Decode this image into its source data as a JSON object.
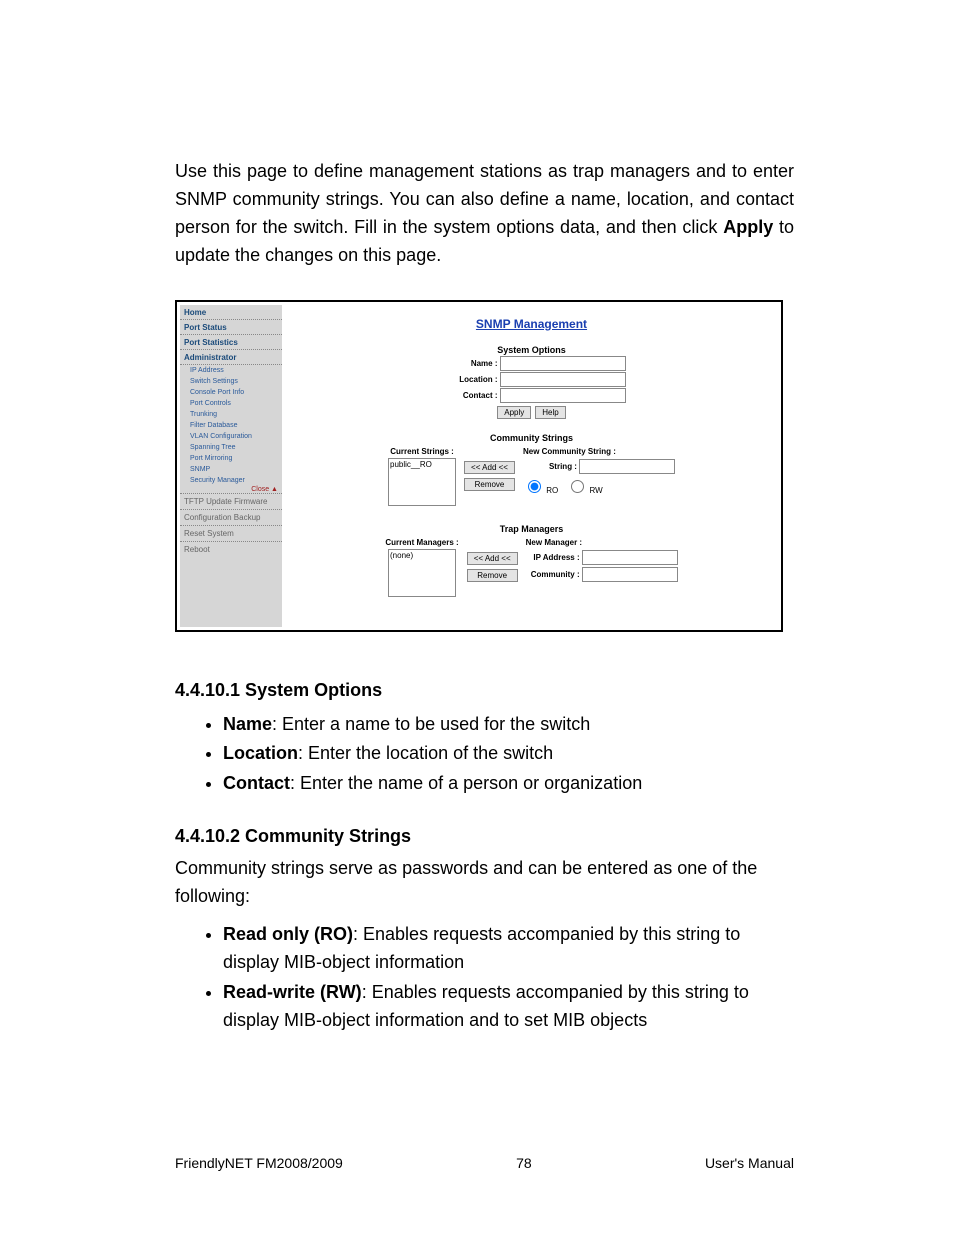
{
  "intro": {
    "pre": "Use this page to define management stations as trap managers and to enter SNMP community strings. You can also define a name, location, and contact person for the switch. Fill in the system options data, and then click ",
    "bold": "Apply",
    "post": " to update the changes on this page."
  },
  "screenshot": {
    "title": "SNMP Management",
    "sidebar": {
      "home": "Home",
      "port_status": "Port Status",
      "port_statistics": "Port Statistics",
      "administrator": "Administrator",
      "subs": [
        "IP Address",
        "Switch Settings",
        "Console Port Info",
        "Port Controls",
        "Trunking",
        "Filter Database",
        "VLAN Configuration",
        "Spanning Tree",
        "Port Mirroring",
        "SNMP",
        "Security Manager"
      ],
      "close": "Close ▲",
      "tftp": "TFTP Update Firmware",
      "cfg": "Configuration Backup",
      "reset": "Reset System",
      "reboot": "Reboot"
    },
    "system_options": {
      "heading": "System Options",
      "name_label": "Name :",
      "location_label": "Location :",
      "contact_label": "Contact :",
      "apply": "Apply",
      "help": "Help"
    },
    "community": {
      "heading": "Community Strings",
      "current_label": "Current Strings :",
      "new_label": "New Community String :",
      "current_value": "public__RO",
      "add": "<< Add <<",
      "remove": "Remove",
      "string_label": "String :",
      "ro": "RO",
      "rw": "RW"
    },
    "trap": {
      "heading": "Trap Managers",
      "current_label": "Current Managers :",
      "new_label": "New Manager :",
      "current_value": "(none)",
      "add": "<< Add <<",
      "remove": "Remove",
      "ip_label": "IP Address :",
      "community_label": "Community :"
    }
  },
  "sections": {
    "s1_title": "4.4.10.1 System Options",
    "s1_items": [
      {
        "term": "Name",
        "desc": ": Enter a name to be used for the switch"
      },
      {
        "term": "Location",
        "desc": ": Enter the location of the switch"
      },
      {
        "term": "Contact",
        "desc": ": Enter the name of a person or organization"
      }
    ],
    "s2_title": "4.4.10.2 Community Strings",
    "s2_para": "Community strings serve as passwords and can be entered as one of the following:",
    "s2_items": [
      {
        "term": "Read only (RO)",
        "desc": ": Enables requests accompanied by this string to display MIB-object information"
      },
      {
        "term": "Read-write (RW)",
        "desc": ": Enables requests accompanied by this string to display MIB-object information and to set MIB objects"
      }
    ]
  },
  "footer": {
    "left": "FriendlyNET FM2008/2009",
    "center": "78",
    "right": "User's Manual"
  }
}
